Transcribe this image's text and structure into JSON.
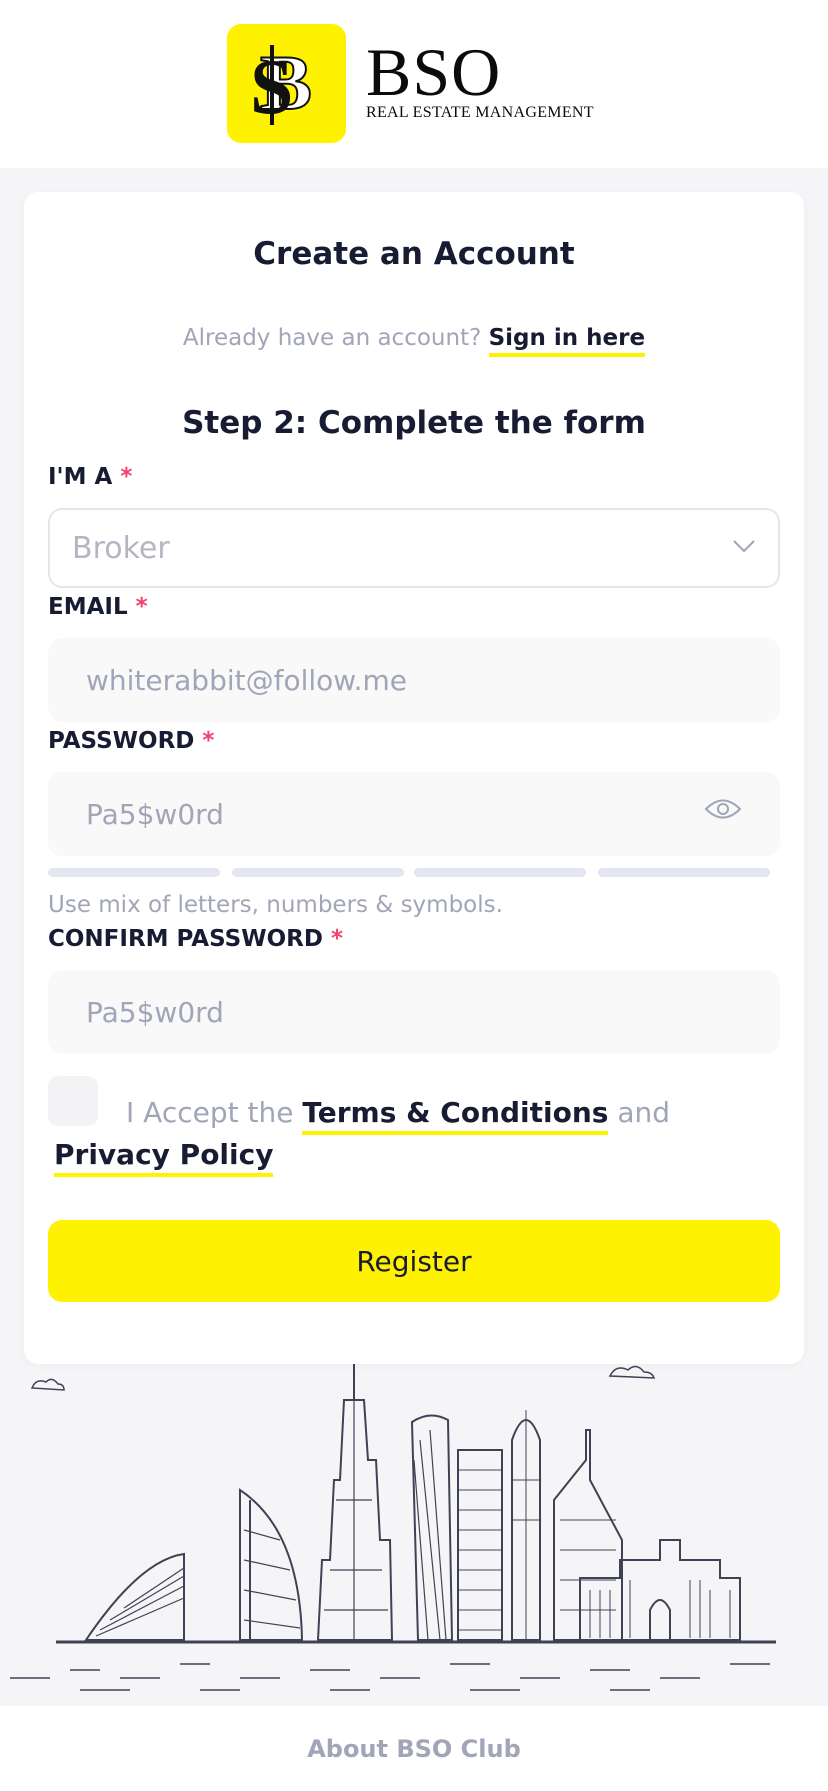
{
  "brand": {
    "title": "BSO",
    "subtitle": "REAL ESTATE MANAGEMENT",
    "monogram": "SB",
    "accent_color": "#fff200"
  },
  "form": {
    "title": "Create an Account",
    "signin_prompt": "Already have an account?",
    "signin_link": "Sign in here",
    "step_title": "Step 2: Complete the form",
    "role": {
      "label": "I'M A",
      "required_mark": "*",
      "value": "Broker"
    },
    "email": {
      "label": "EMAIL",
      "required_mark": "*",
      "placeholder": "whiterabbit@follow.me"
    },
    "password": {
      "label": "PASSWORD",
      "required_mark": "*",
      "placeholder": "Pa5$w0rd",
      "strength": 0
    },
    "password_hint": "Use mix of letters, numbers & symbols.",
    "confirm_password": {
      "label": "CONFIRM PASSWORD",
      "required_mark": "*",
      "placeholder": "Pa5$w0rd"
    },
    "terms": {
      "prefix": "I Accept the",
      "terms_link": "Terms & Conditions",
      "conjunction": "and",
      "privacy_link": "Privacy Policy",
      "checked": false
    },
    "submit_label": "Register"
  },
  "footer": {
    "link": "About BSO Club"
  },
  "icons": {
    "role_dropdown": "chevron-down-icon",
    "password_toggle": "eye-icon"
  }
}
